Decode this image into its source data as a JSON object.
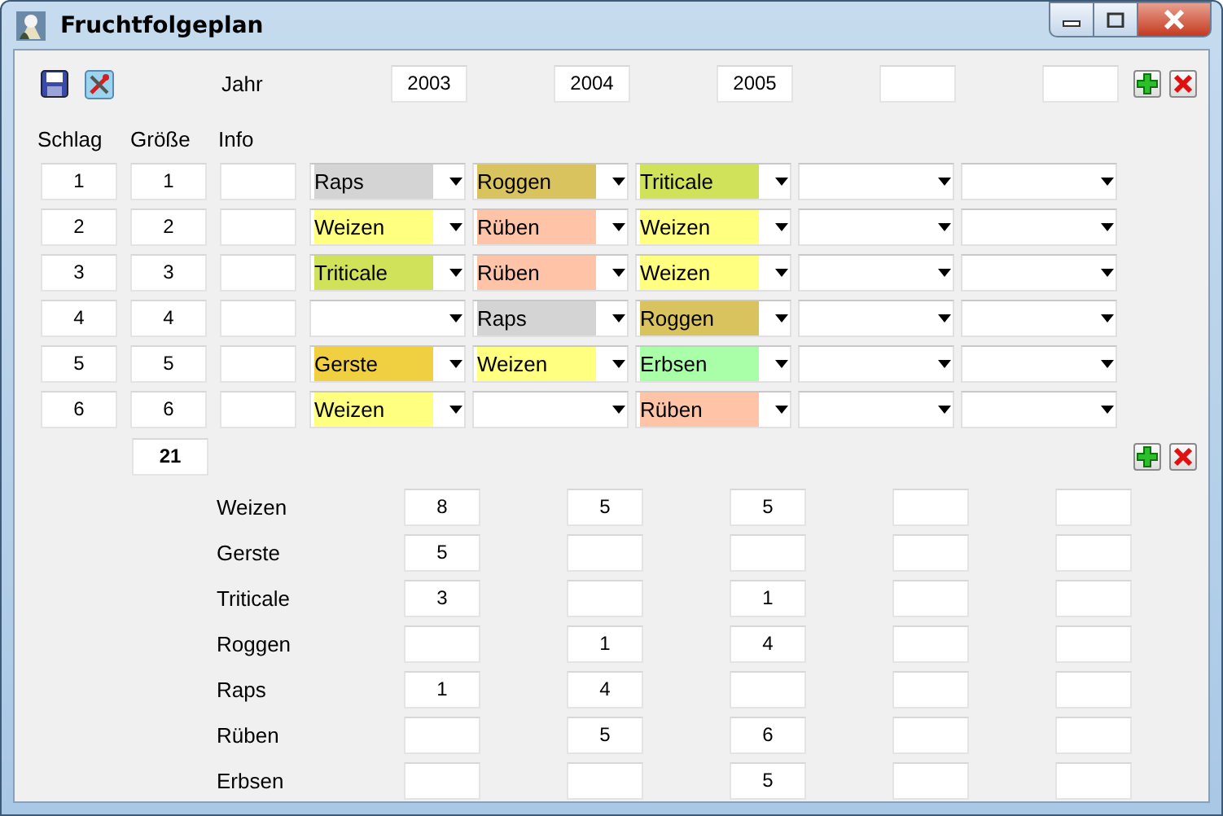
{
  "window": {
    "title": "Fruchtfolgeplan"
  },
  "toolbar": {
    "year_label": "Jahr"
  },
  "years": [
    {
      "kind": "value",
      "text": "2003"
    },
    {
      "kind": "value",
      "text": "2004"
    },
    {
      "kind": "value",
      "text": "2005"
    },
    {
      "kind": "blank"
    },
    {
      "kind": "blank"
    }
  ],
  "columns": [
    "Schlag",
    "Größe",
    "Info"
  ],
  "fields": [
    {
      "schlag": "1",
      "groesse": "1",
      "crops": [
        {
          "kind": "crop",
          "crop": "Raps",
          "color": "#d4d4d4"
        },
        {
          "kind": "crop",
          "crop": "Roggen",
          "color": "#d8c35e"
        },
        {
          "kind": "crop",
          "crop": "Triticale",
          "color": "#d0e25a"
        },
        {
          "kind": "blank"
        },
        {
          "kind": "blank"
        }
      ]
    },
    {
      "schlag": "2",
      "groesse": "2",
      "crops": [
        {
          "kind": "crop",
          "crop": "Weizen",
          "color": "#ffff80"
        },
        {
          "kind": "crop",
          "crop": "Rüben",
          "color": "#ffc4a8"
        },
        {
          "kind": "crop",
          "crop": "Weizen",
          "color": "#ffff80"
        },
        {
          "kind": "blank"
        },
        {
          "kind": "blank"
        }
      ]
    },
    {
      "schlag": "3",
      "groesse": "3",
      "crops": [
        {
          "kind": "crop",
          "crop": "Triticale",
          "color": "#d0e25a"
        },
        {
          "kind": "crop",
          "crop": "Rüben",
          "color": "#ffc4a8"
        },
        {
          "kind": "crop",
          "crop": "Weizen",
          "color": "#ffff80"
        },
        {
          "kind": "blank"
        },
        {
          "kind": "blank"
        }
      ]
    },
    {
      "schlag": "4",
      "groesse": "4",
      "crops": [
        {
          "kind": "blank"
        },
        {
          "kind": "crop",
          "crop": "Raps",
          "color": "#d4d4d4"
        },
        {
          "kind": "crop",
          "crop": "Roggen",
          "color": "#d8c35e"
        },
        {
          "kind": "blank"
        },
        {
          "kind": "blank"
        }
      ]
    },
    {
      "schlag": "5",
      "groesse": "5",
      "crops": [
        {
          "kind": "crop",
          "crop": "Gerste",
          "color": "#f0d040"
        },
        {
          "kind": "crop",
          "crop": "Weizen",
          "color": "#ffff80"
        },
        {
          "kind": "crop",
          "crop": "Erbsen",
          "color": "#a8ffa8"
        },
        {
          "kind": "blank"
        },
        {
          "kind": "blank"
        }
      ]
    },
    {
      "schlag": "6",
      "groesse": "6",
      "crops": [
        {
          "kind": "crop",
          "crop": "Weizen",
          "color": "#ffff80"
        },
        {
          "kind": "blank"
        },
        {
          "kind": "crop",
          "crop": "Rüben",
          "color": "#ffc4a8"
        },
        {
          "kind": "blank"
        },
        {
          "kind": "blank"
        }
      ]
    }
  ],
  "total": "21",
  "summary": [
    {
      "crop": "Weizen",
      "counts": [
        {
          "kind": "value",
          "text": "8"
        },
        {
          "kind": "value",
          "text": "5"
        },
        {
          "kind": "value",
          "text": "5"
        },
        {
          "kind": "blank"
        },
        {
          "kind": "blank"
        }
      ]
    },
    {
      "crop": "Gerste",
      "counts": [
        {
          "kind": "value",
          "text": "5"
        },
        {
          "kind": "blank"
        },
        {
          "kind": "blank"
        },
        {
          "kind": "blank"
        },
        {
          "kind": "blank"
        }
      ]
    },
    {
      "crop": "Triticale",
      "counts": [
        {
          "kind": "value",
          "text": "3"
        },
        {
          "kind": "blank"
        },
        {
          "kind": "value",
          "text": "1"
        },
        {
          "kind": "blank"
        },
        {
          "kind": "blank"
        }
      ]
    },
    {
      "crop": "Roggen",
      "counts": [
        {
          "kind": "blank"
        },
        {
          "kind": "value",
          "text": "1"
        },
        {
          "kind": "value",
          "text": "4"
        },
        {
          "kind": "blank"
        },
        {
          "kind": "blank"
        }
      ]
    },
    {
      "crop": "Raps",
      "counts": [
        {
          "kind": "value",
          "text": "1"
        },
        {
          "kind": "value",
          "text": "4"
        },
        {
          "kind": "blank"
        },
        {
          "kind": "blank"
        },
        {
          "kind": "blank"
        }
      ]
    },
    {
      "crop": "Rüben",
      "counts": [
        {
          "kind": "blank"
        },
        {
          "kind": "value",
          "text": "5"
        },
        {
          "kind": "value",
          "text": "6"
        },
        {
          "kind": "blank"
        },
        {
          "kind": "blank"
        }
      ]
    },
    {
      "crop": "Erbsen",
      "counts": [
        {
          "kind": "blank"
        },
        {
          "kind": "blank"
        },
        {
          "kind": "value",
          "text": "5"
        },
        {
          "kind": "blank"
        },
        {
          "kind": "blank"
        }
      ]
    }
  ]
}
